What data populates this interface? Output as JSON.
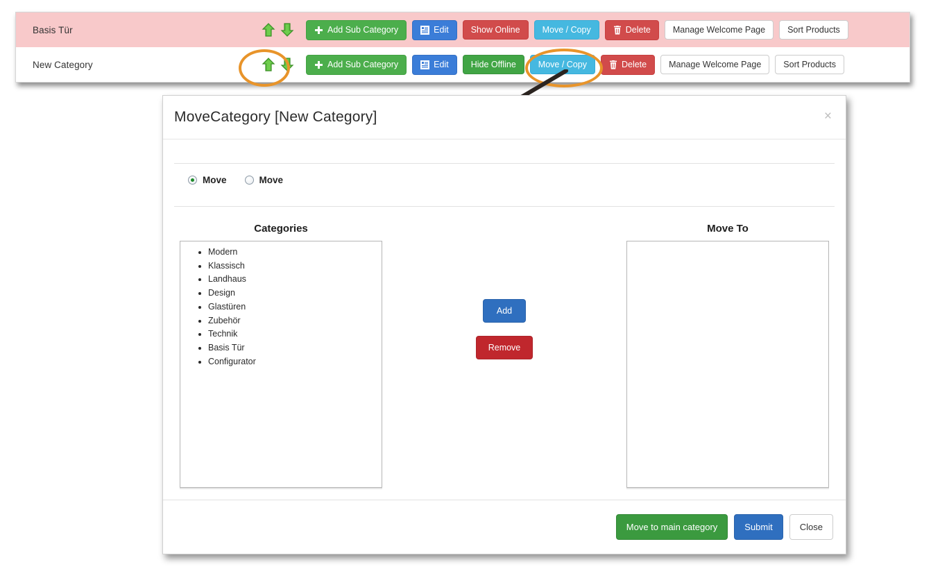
{
  "category_panel": {
    "rows": [
      {
        "name": "Basis Tür",
        "highlighted": true,
        "move_up_icon": "arrow-up-icon",
        "move_down_icon": "arrow-down-icon",
        "add_sub_category": "Add Sub Category",
        "edit": "Edit",
        "visibility": "Show Online",
        "move_copy": "Move / Copy",
        "delete": "Delete",
        "manage_welcome_page": "Manage Welcome Page",
        "sort_products": "Sort Products"
      },
      {
        "name": "New Category",
        "highlighted": false,
        "move_up_icon": "arrow-up-icon",
        "move_down_icon": "arrow-down-icon",
        "add_sub_category": "Add Sub Category",
        "edit": "Edit",
        "visibility": "Hide Offline",
        "move_copy": "Move / Copy",
        "delete": "Delete",
        "manage_welcome_page": "Manage Welcome Page",
        "sort_products": "Sort Products"
      }
    ]
  },
  "annotations": {
    "ellipse_color": "#e8942a",
    "arrow_color": "#2b2420"
  },
  "modal": {
    "title": "MoveCategory  [New Category]",
    "close_icon": "×",
    "radios": [
      {
        "label": "Move",
        "checked": true
      },
      {
        "label": "Move",
        "checked": false
      }
    ],
    "source_panel": {
      "heading": "Categories",
      "items": [
        "Modern",
        "Klassisch",
        "Landhaus",
        "Design",
        "Glastüren",
        "Zubehör",
        "Technik",
        "Basis Tür",
        "Configurator"
      ]
    },
    "target_panel": {
      "heading": "Move To",
      "items": []
    },
    "transfer_buttons": {
      "add": "Add",
      "remove": "Remove"
    },
    "footer": {
      "move_to_main_category": "Move to main category",
      "submit": "Submit",
      "close": "Close"
    }
  },
  "colors": {
    "row_highlight": "#f8c9ca",
    "green": "#4cae4c",
    "blue": "#3b7dd8",
    "red": "#d14b4b",
    "cyan": "#45b8e0",
    "success_green": "#41a545",
    "accent_orange": "#e8942a"
  }
}
